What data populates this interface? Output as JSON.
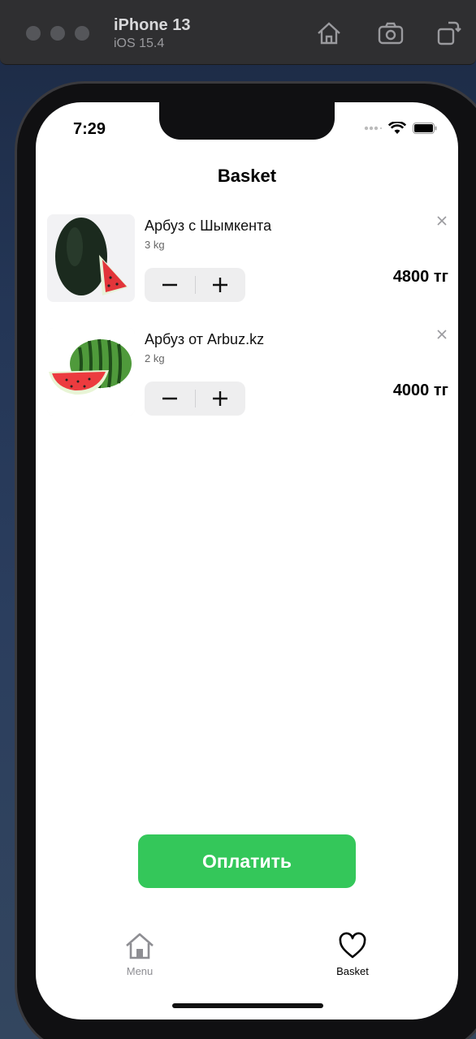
{
  "simulator": {
    "device": "iPhone 13",
    "os": "iOS 15.4",
    "icons": [
      "home-icon",
      "screenshot-icon",
      "rotate-icon"
    ]
  },
  "status_bar": {
    "time": "7:29"
  },
  "page": {
    "title": "Basket"
  },
  "basket": {
    "items": [
      {
        "name": "Арбуз с Шымкента",
        "weight": "3 kg",
        "price": "4800 тг",
        "image": "dark-watermelon-image"
      },
      {
        "name": "Арбуз от Arbuz.kz",
        "weight": "2 kg",
        "price": "4000 тг",
        "image": "striped-watermelon-image"
      }
    ]
  },
  "pay_button": {
    "label": "Оплатить",
    "color": "#34c75a"
  },
  "tabbar": {
    "menu": {
      "label": "Menu",
      "icon": "home-icon",
      "color": "#8e8e93"
    },
    "basket": {
      "label": "Basket",
      "icon": "heart-icon",
      "color": "#000000"
    }
  }
}
